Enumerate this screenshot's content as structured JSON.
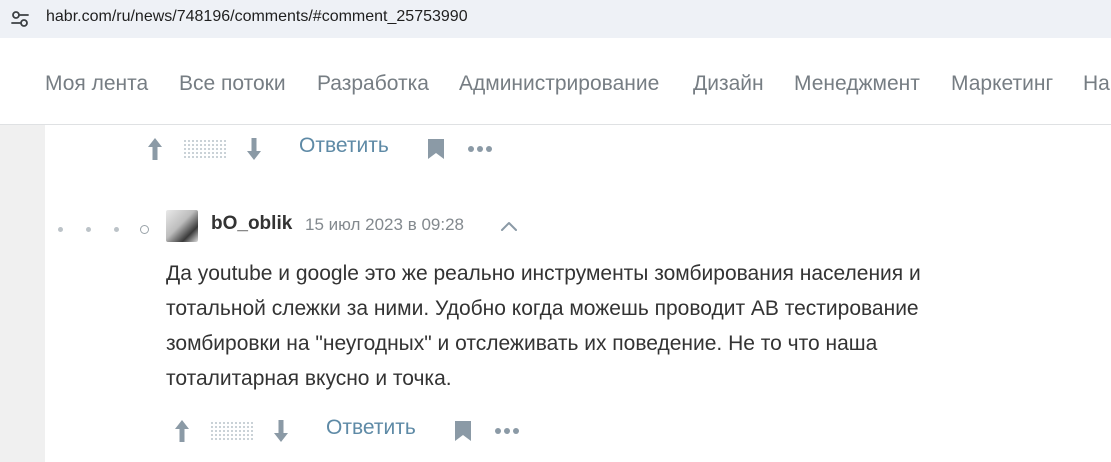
{
  "browser": {
    "url": "habr.com/ru/news/748196/comments/#comment_25753990",
    "site_info_icon": "tune-icon"
  },
  "nav": {
    "items": [
      "Моя лента",
      "Все потоки",
      "Разработка",
      "Администрирование",
      "Дизайн",
      "Менеджмент",
      "Маркетинг",
      "На"
    ]
  },
  "prev_comment": {
    "reply_label": "Ответить"
  },
  "comment": {
    "author": "bO_oblik",
    "timestamp": "15 июл 2023 в 09:28",
    "body_lines": [
      "Да youtube и google это же реально инструменты зомбирования населения и",
      "тотальной слежки за ними. Удобно когда можешь проводит AB тестирование",
      "зомбировки на \"неугодных\" и отслеживать их поведение. Не то что наша",
      "тоталитарная вкусно и точка."
    ],
    "reply_label": "Ответить"
  },
  "colors": {
    "nav_text": "#767d83",
    "link": "#5e8aa6",
    "icon": "#8b9aa6",
    "text": "#333333",
    "meta": "#83898e",
    "rail": "#f0f0f0",
    "address_bg": "#eef1f6"
  },
  "icons": [
    "tune-icon",
    "upvote-arrow-icon",
    "downvote-arrow-icon",
    "bookmark-icon",
    "more-dots-icon",
    "chevron-up-icon",
    "thread-level-dots-icon"
  ]
}
